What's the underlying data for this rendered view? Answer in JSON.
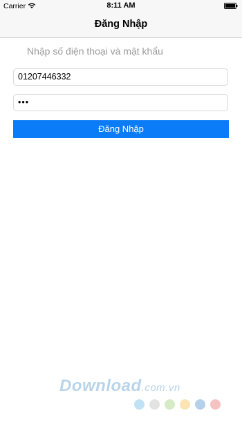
{
  "status_bar": {
    "carrier": "Carrier",
    "wifi_icon": "wifi-icon",
    "time": "8:11 AM",
    "battery_icon": "battery-icon"
  },
  "nav": {
    "title": "Đăng Nhập"
  },
  "form": {
    "prompt": "Nhập số điện thoại và mật khẩu",
    "phone_value": "01207446332",
    "password_value": "•••",
    "submit_label": "Đăng Nhập"
  },
  "watermark": {
    "text_main": "Download",
    "text_sub": ".com.vn",
    "dot_colors": [
      "#bfe3f5",
      "#e3e3e3",
      "#d4ebc6",
      "#fbe3b3",
      "#b5d0ea",
      "#f6c3c3"
    ]
  },
  "colors": {
    "accent": "#0a7cf8",
    "bar_background": "#f7f7f7",
    "prompt_text": "#9b9b9b"
  }
}
